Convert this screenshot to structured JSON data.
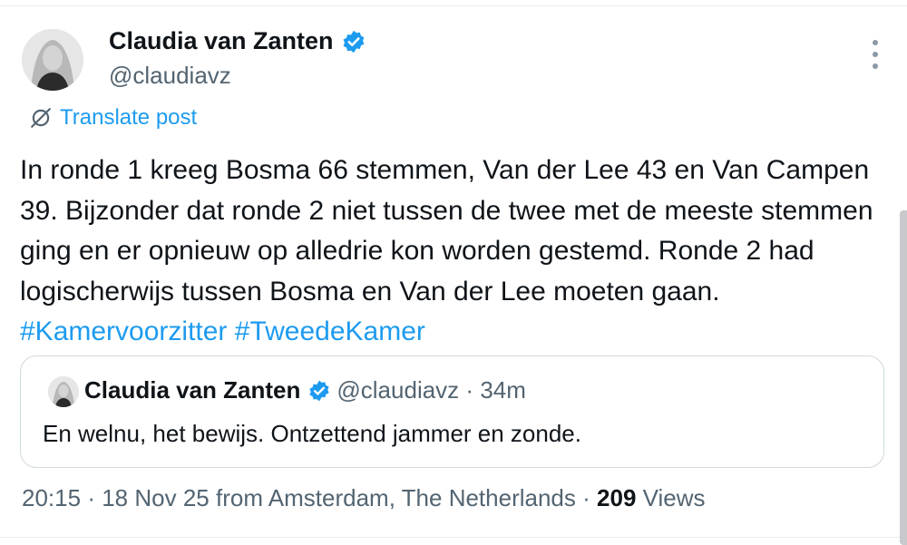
{
  "author": {
    "name": "Claudia van Zanten",
    "handle": "@claudiavz",
    "verified": true
  },
  "translate_label": "Translate post",
  "post": {
    "text": "In ronde 1 kreeg Bosma 66 stemmen, Van der Lee 43 en Van Campen 39. Bijzonder dat ronde 2 niet tussen de twee met de meeste stemmen ging en er opnieuw op alledrie kon worden gestemd. Ronde 2 had logischerwijs tussen Bosma en Van der Lee moeten gaan. ",
    "hashtags": [
      "#Kamervoorzitter",
      "#TweedeKamer"
    ]
  },
  "quote": {
    "name": "Claudia van Zanten",
    "handle": "@claudiavz",
    "separator": "·",
    "time": "34m",
    "text": "En welnu, het bewijs. Ontzettend jammer en zonde."
  },
  "footer": {
    "time": "20:15",
    "separator1": "·",
    "date": "18 Nov 25",
    "location": "from Amsterdam, The Netherlands",
    "separator2": "·",
    "views_count": "209",
    "views_label": "Views"
  },
  "colors": {
    "accent": "#1d9bf0",
    "text_primary": "#0f1419",
    "text_secondary": "#536471",
    "border": "#cfd9de"
  }
}
